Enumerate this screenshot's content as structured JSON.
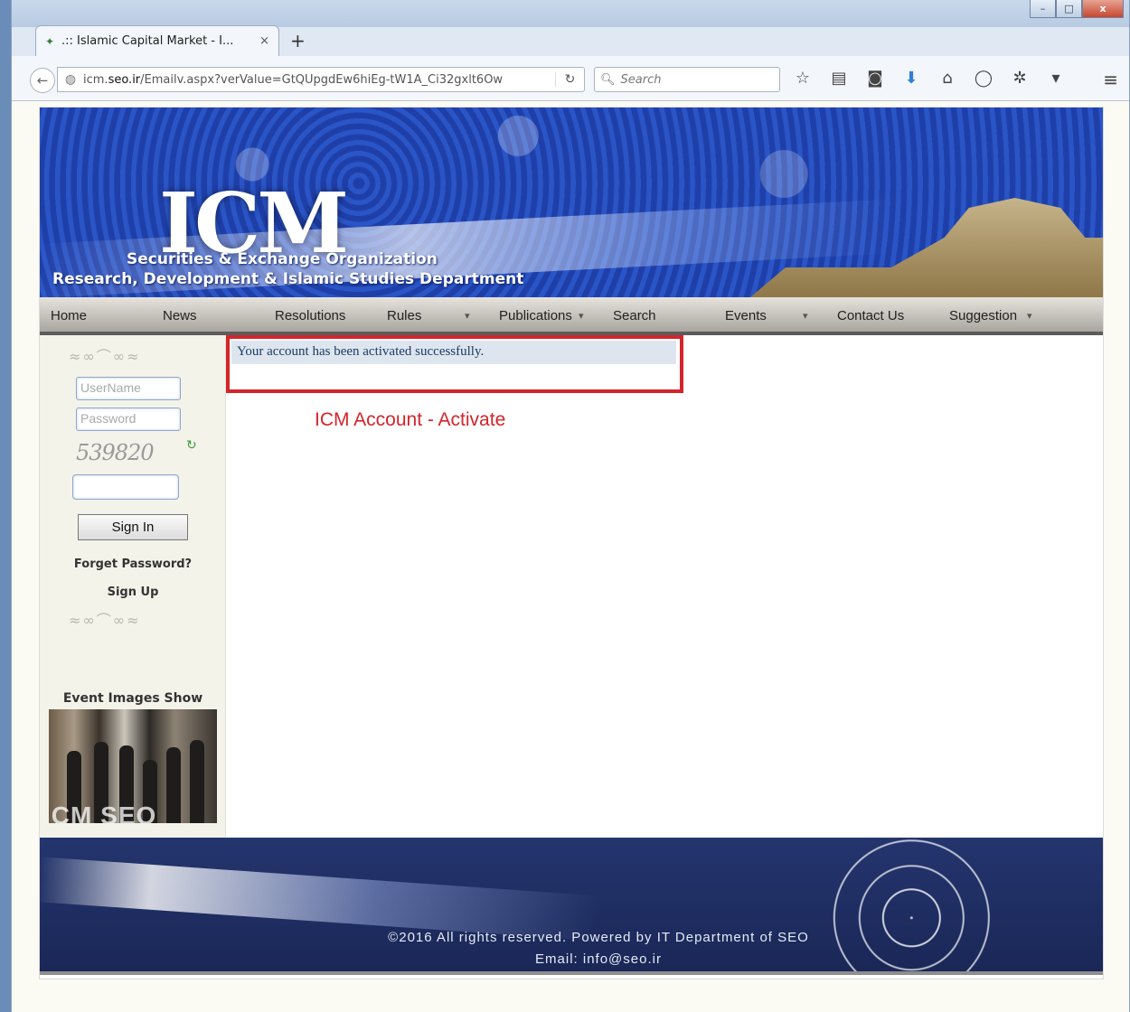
{
  "browser": {
    "tab_title": ".:: Islamic Capital Market - I...",
    "tab_close": "×",
    "new_tab": "+",
    "url_prefix": "icm.",
    "url_domain": "seo.ir",
    "url_rest": "/Emailv.aspx?verValue=GtQUpgdEw6hiEg-tW1A_Ci32gxlt6Ow",
    "search_placeholder": "Search",
    "window_buttons": {
      "minimize": "–",
      "maximize": "□",
      "close": "x"
    }
  },
  "banner": {
    "logo": "ICM",
    "line1": "Securities & Exchange Organization",
    "line2": "Research, Development & Islamic Studies Department"
  },
  "menu": {
    "items": [
      "Home",
      "News",
      "Resolutions",
      "Rules",
      "Publications",
      "Search",
      "Events",
      "Contact Us",
      "Suggestion"
    ]
  },
  "login": {
    "username_placeholder": "UserName",
    "password_placeholder": "Password",
    "captcha": "539820",
    "signin_label": "Sign In",
    "forget_password": "Forget Password?",
    "sign_up": "Sign Up"
  },
  "events": {
    "title": "Event Images Show",
    "image_caption": "ICM SEO"
  },
  "main": {
    "success_message": "Your account has been activated successfully.",
    "heading": "ICM Account - Activate"
  },
  "footer": {
    "copyright": "©2016 All rights reserved. Powered by IT Department of SEO",
    "email": "Email: info@seo.ir"
  },
  "colors": {
    "heading_red": "#d4242a",
    "banner_blue": "#2347b6",
    "footer_navy": "#1a2757"
  }
}
